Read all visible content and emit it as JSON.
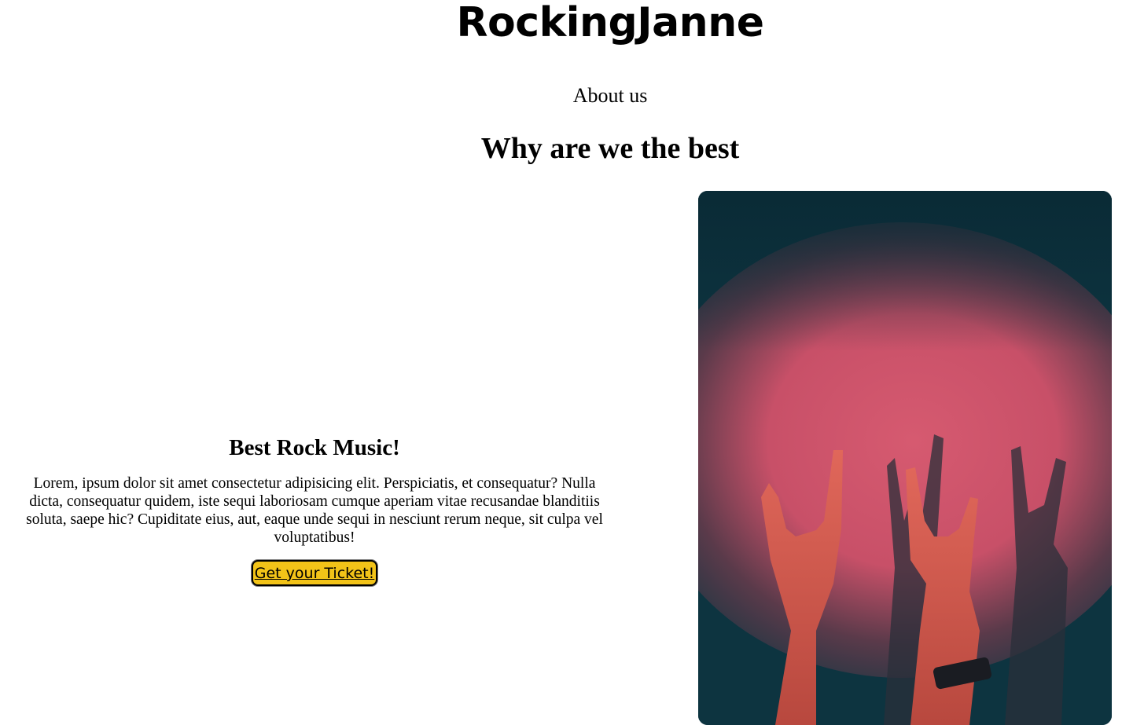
{
  "header": {
    "site_title": "RockingJanne",
    "nav_link": "About us"
  },
  "main": {
    "section_heading": "Why are we the best",
    "feature": {
      "title": "Best Rock Music!",
      "body": "Lorem, ipsum dolor sit amet consectetur adipisicing elit. Perspiciatis, et consequatur? Nulla dicta, consequatur quidem, iste sequi laboriosam cumque aperiam vitae recusandae blanditiis soluta, saepe hic? Cupiditate eius, aut, eaque unde sequi in nesciunt rerum neque, sit culpa vel voluptatibus!",
      "button_label": "Get your Ticket!"
    }
  },
  "colors": {
    "button_bg": "#f2c318",
    "photo_background": "#0d3440",
    "photo_spotlight": "#d65a70"
  }
}
